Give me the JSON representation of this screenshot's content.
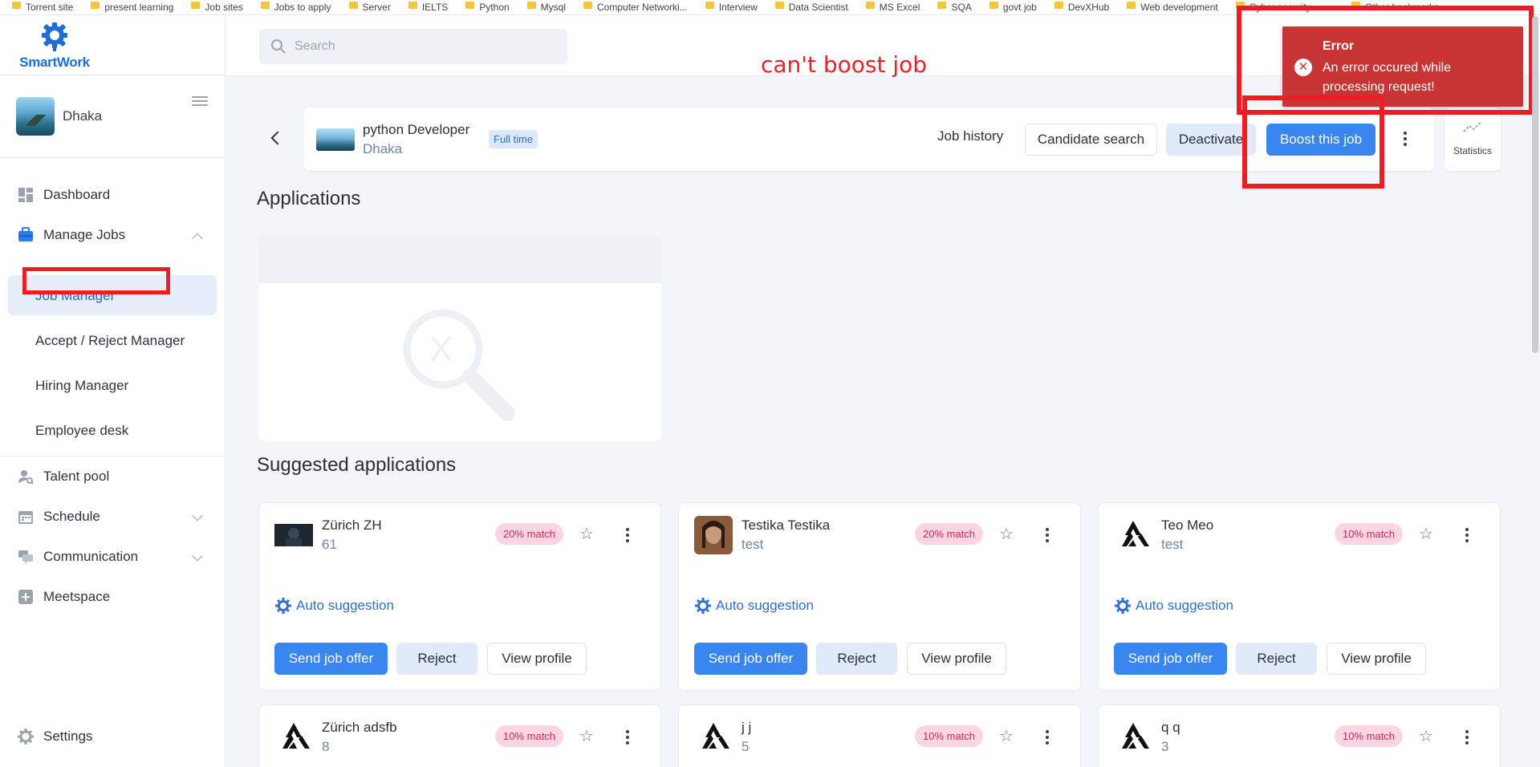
{
  "bookmarks": [
    "Torrent site",
    "present learning",
    "Job sites",
    "Jobs to apply",
    "Server",
    "IELTS",
    "Python",
    "Mysql",
    "Computer Networki...",
    "Interview",
    "Data Scientist",
    "MS Excel",
    "SQA",
    "govt job",
    "DevXHub",
    "Web development",
    "Cyber security",
    "»",
    "Other bookmarks"
  ],
  "app": {
    "name": "SmartWork"
  },
  "sidebar": {
    "org_name": "Dhaka",
    "nav": {
      "dashboard": "Dashboard",
      "manage_jobs": "Manage Jobs",
      "job_manager": "Job Manager",
      "accept_reject": "Accept / Reject Manager",
      "hiring": "Hiring Manager",
      "employee_desk": "Employee desk",
      "talent_pool": "Talent pool",
      "schedule": "Schedule",
      "communication": "Communication",
      "meetspace": "Meetspace",
      "settings": "Settings"
    }
  },
  "search": {
    "placeholder": "Search"
  },
  "annotation": "can't boost job",
  "job": {
    "title": "python Developer",
    "location": "Dhaka",
    "type": "Full time",
    "actions": {
      "history": "Job history",
      "candidate_search": "Candidate search",
      "deactivate": "Deactivate",
      "boost": "Boost this job",
      "statistics": "Statistics"
    }
  },
  "sections": {
    "applications": "Applications",
    "suggested": "Suggested applications"
  },
  "card_labels": {
    "auto": "Auto suggestion",
    "offer": "Send job offer",
    "reject": "Reject",
    "view": "View profile"
  },
  "candidates": [
    {
      "name": "Zürich ZH",
      "sub": "61",
      "match": "20% match",
      "avatar": "dark-photo"
    },
    {
      "name": "Testika Testika",
      "sub": "test",
      "match": "20% match",
      "avatar": "portrait-photo"
    },
    {
      "name": "Teo Meo",
      "sub": "test",
      "match": "10% match",
      "avatar": "triangle-logo"
    },
    {
      "name": "Zürich adsfb",
      "sub": "8",
      "match": "10% match",
      "avatar": "triangle-logo"
    },
    {
      "name": "j j",
      "sub": "5",
      "match": "10% match",
      "avatar": "triangle-logo"
    },
    {
      "name": "q q",
      "sub": "3",
      "match": "10% match",
      "avatar": "triangle-logo"
    }
  ],
  "toast": {
    "title": "Error",
    "message": "An error occured while processing request!"
  },
  "colors": {
    "primary": "#3a86f0",
    "brand": "#1d6fd6",
    "error": "#c93535",
    "annotation": "#ee1d23",
    "match_badge": "#fbd5e2"
  }
}
